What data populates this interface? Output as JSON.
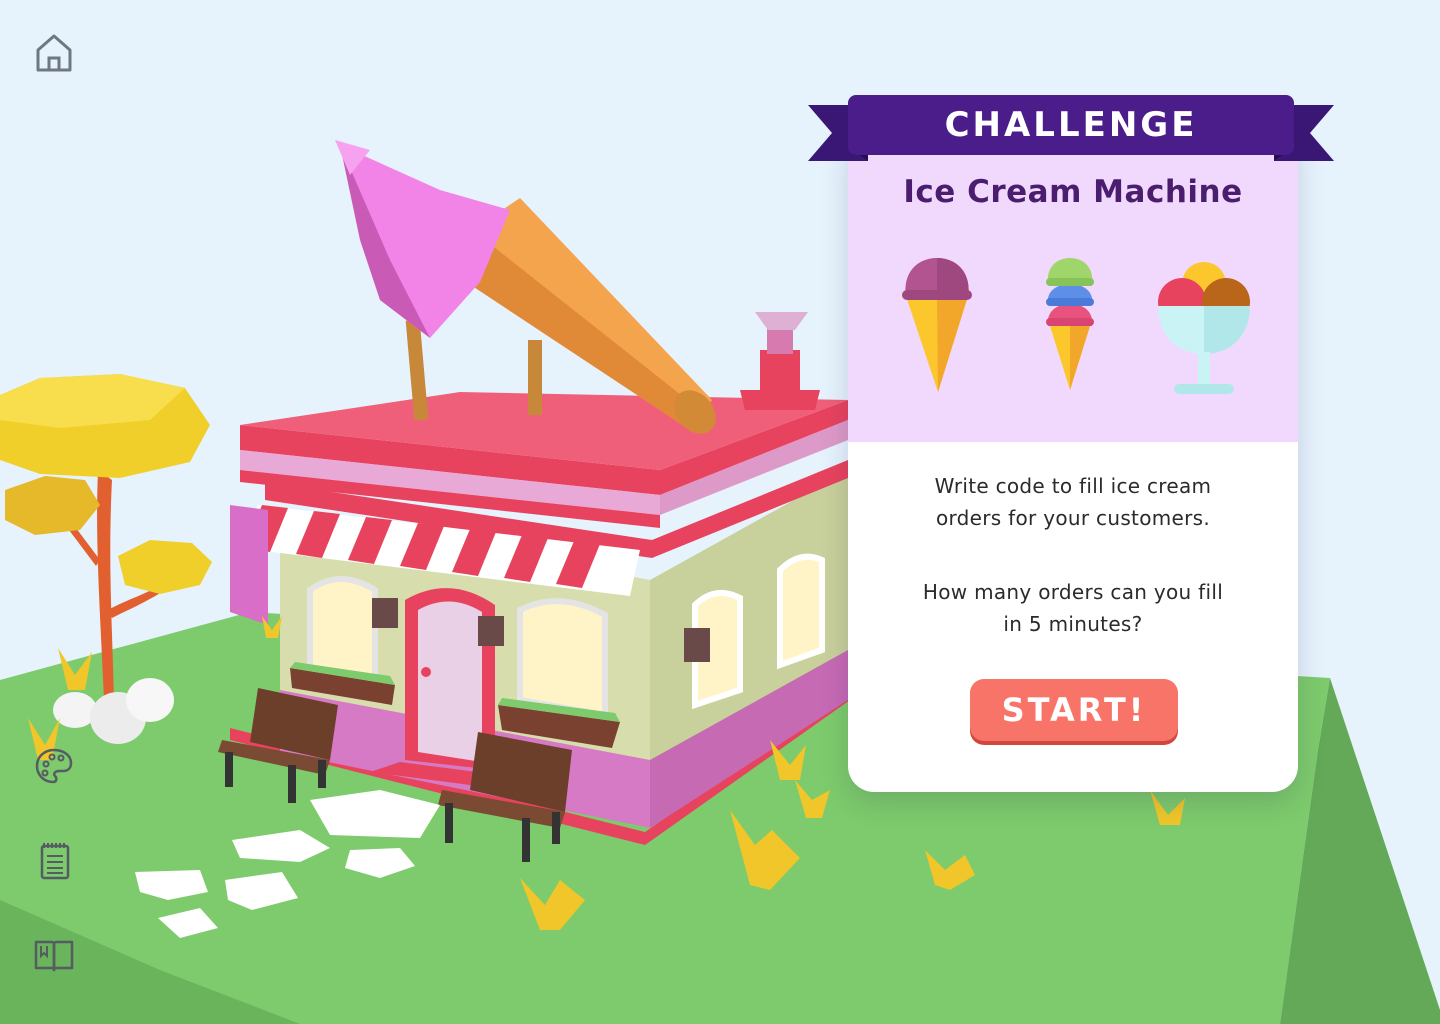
{
  "toolbar": {
    "home_icon": "home-icon",
    "palette_icon": "palette-icon",
    "notebook_icon": "notebook-icon",
    "book_icon": "book-icon"
  },
  "challenge": {
    "banner": "CHALLENGE",
    "title": "Ice Cream Machine",
    "description_lines": [
      "Write code to fill ice cream",
      "orders for your customers."
    ],
    "question_lines": [
      "How many orders can you fill",
      "in 5 minutes?"
    ],
    "start_label": "START!",
    "treats": [
      "single-scoop-cone",
      "triple-scoop-cone",
      "sundae-bowl"
    ]
  },
  "colors": {
    "banner": "#4a1d8a",
    "card_header": "#f1d9fd",
    "start_button": "#f87468",
    "grass": "#7dcb6c",
    "sky": "#e6f3fd"
  }
}
